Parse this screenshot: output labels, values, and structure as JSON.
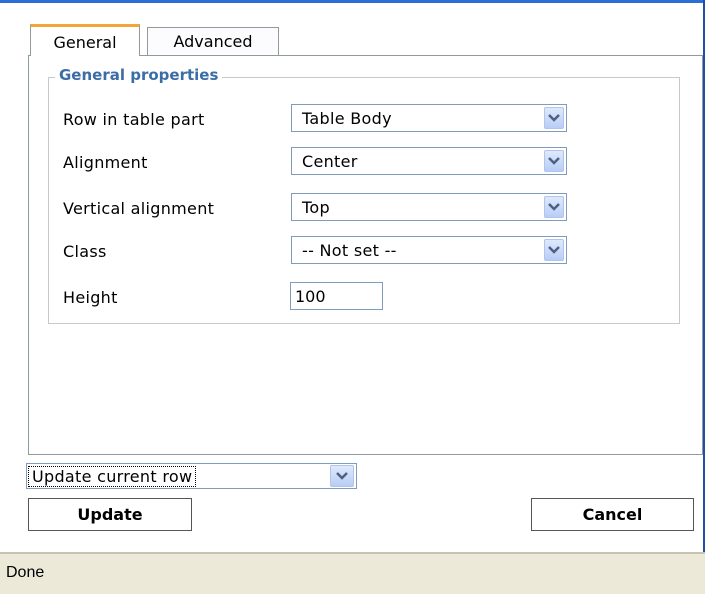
{
  "tabs": [
    {
      "label": "General",
      "active": true
    },
    {
      "label": "Advanced",
      "active": false
    }
  ],
  "general": {
    "legend": "General properties",
    "rows": [
      {
        "label": "Row in table part",
        "value": "Table Body"
      },
      {
        "label": "Alignment",
        "value": "Center"
      },
      {
        "label": "Vertical alignment",
        "value": "Top"
      },
      {
        "label": "Class",
        "value": "-- Not set --"
      }
    ],
    "height": {
      "label": "Height",
      "value": "100"
    }
  },
  "footer": {
    "mode_select": "Update current row",
    "update_label": "Update",
    "cancel_label": "Cancel"
  },
  "status": {
    "text": "Done"
  },
  "colors": {
    "accent_tab": "#f2a53a",
    "legend": "#3b6da6",
    "statusbar": "#ece9d8"
  }
}
